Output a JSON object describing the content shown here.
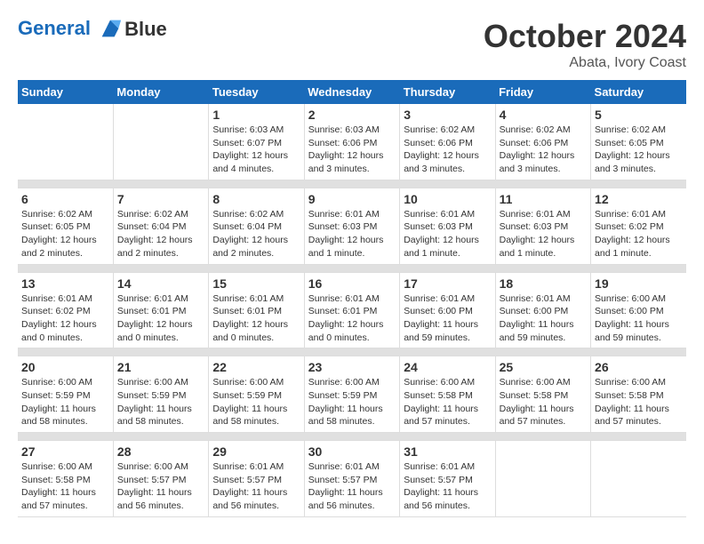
{
  "header": {
    "logo_line1": "General",
    "logo_line2": "Blue",
    "month": "October 2024",
    "location": "Abata, Ivory Coast"
  },
  "weekdays": [
    "Sunday",
    "Monday",
    "Tuesday",
    "Wednesday",
    "Thursday",
    "Friday",
    "Saturday"
  ],
  "weeks": [
    [
      {
        "day": "",
        "info": ""
      },
      {
        "day": "",
        "info": ""
      },
      {
        "day": "1",
        "info": "Sunrise: 6:03 AM\nSunset: 6:07 PM\nDaylight: 12 hours and 4 minutes."
      },
      {
        "day": "2",
        "info": "Sunrise: 6:03 AM\nSunset: 6:06 PM\nDaylight: 12 hours and 3 minutes."
      },
      {
        "day": "3",
        "info": "Sunrise: 6:02 AM\nSunset: 6:06 PM\nDaylight: 12 hours and 3 minutes."
      },
      {
        "day": "4",
        "info": "Sunrise: 6:02 AM\nSunset: 6:06 PM\nDaylight: 12 hours and 3 minutes."
      },
      {
        "day": "5",
        "info": "Sunrise: 6:02 AM\nSunset: 6:05 PM\nDaylight: 12 hours and 3 minutes."
      }
    ],
    [
      {
        "day": "6",
        "info": "Sunrise: 6:02 AM\nSunset: 6:05 PM\nDaylight: 12 hours and 2 minutes."
      },
      {
        "day": "7",
        "info": "Sunrise: 6:02 AM\nSunset: 6:04 PM\nDaylight: 12 hours and 2 minutes."
      },
      {
        "day": "8",
        "info": "Sunrise: 6:02 AM\nSunset: 6:04 PM\nDaylight: 12 hours and 2 minutes."
      },
      {
        "day": "9",
        "info": "Sunrise: 6:01 AM\nSunset: 6:03 PM\nDaylight: 12 hours and 1 minute."
      },
      {
        "day": "10",
        "info": "Sunrise: 6:01 AM\nSunset: 6:03 PM\nDaylight: 12 hours and 1 minute."
      },
      {
        "day": "11",
        "info": "Sunrise: 6:01 AM\nSunset: 6:03 PM\nDaylight: 12 hours and 1 minute."
      },
      {
        "day": "12",
        "info": "Sunrise: 6:01 AM\nSunset: 6:02 PM\nDaylight: 12 hours and 1 minute."
      }
    ],
    [
      {
        "day": "13",
        "info": "Sunrise: 6:01 AM\nSunset: 6:02 PM\nDaylight: 12 hours and 0 minutes."
      },
      {
        "day": "14",
        "info": "Sunrise: 6:01 AM\nSunset: 6:01 PM\nDaylight: 12 hours and 0 minutes."
      },
      {
        "day": "15",
        "info": "Sunrise: 6:01 AM\nSunset: 6:01 PM\nDaylight: 12 hours and 0 minutes."
      },
      {
        "day": "16",
        "info": "Sunrise: 6:01 AM\nSunset: 6:01 PM\nDaylight: 12 hours and 0 minutes."
      },
      {
        "day": "17",
        "info": "Sunrise: 6:01 AM\nSunset: 6:00 PM\nDaylight: 11 hours and 59 minutes."
      },
      {
        "day": "18",
        "info": "Sunrise: 6:01 AM\nSunset: 6:00 PM\nDaylight: 11 hours and 59 minutes."
      },
      {
        "day": "19",
        "info": "Sunrise: 6:00 AM\nSunset: 6:00 PM\nDaylight: 11 hours and 59 minutes."
      }
    ],
    [
      {
        "day": "20",
        "info": "Sunrise: 6:00 AM\nSunset: 5:59 PM\nDaylight: 11 hours and 58 minutes."
      },
      {
        "day": "21",
        "info": "Sunrise: 6:00 AM\nSunset: 5:59 PM\nDaylight: 11 hours and 58 minutes."
      },
      {
        "day": "22",
        "info": "Sunrise: 6:00 AM\nSunset: 5:59 PM\nDaylight: 11 hours and 58 minutes."
      },
      {
        "day": "23",
        "info": "Sunrise: 6:00 AM\nSunset: 5:59 PM\nDaylight: 11 hours and 58 minutes."
      },
      {
        "day": "24",
        "info": "Sunrise: 6:00 AM\nSunset: 5:58 PM\nDaylight: 11 hours and 57 minutes."
      },
      {
        "day": "25",
        "info": "Sunrise: 6:00 AM\nSunset: 5:58 PM\nDaylight: 11 hours and 57 minutes."
      },
      {
        "day": "26",
        "info": "Sunrise: 6:00 AM\nSunset: 5:58 PM\nDaylight: 11 hours and 57 minutes."
      }
    ],
    [
      {
        "day": "27",
        "info": "Sunrise: 6:00 AM\nSunset: 5:58 PM\nDaylight: 11 hours and 57 minutes."
      },
      {
        "day": "28",
        "info": "Sunrise: 6:00 AM\nSunset: 5:57 PM\nDaylight: 11 hours and 56 minutes."
      },
      {
        "day": "29",
        "info": "Sunrise: 6:01 AM\nSunset: 5:57 PM\nDaylight: 11 hours and 56 minutes."
      },
      {
        "day": "30",
        "info": "Sunrise: 6:01 AM\nSunset: 5:57 PM\nDaylight: 11 hours and 56 minutes."
      },
      {
        "day": "31",
        "info": "Sunrise: 6:01 AM\nSunset: 5:57 PM\nDaylight: 11 hours and 56 minutes."
      },
      {
        "day": "",
        "info": ""
      },
      {
        "day": "",
        "info": ""
      }
    ]
  ]
}
